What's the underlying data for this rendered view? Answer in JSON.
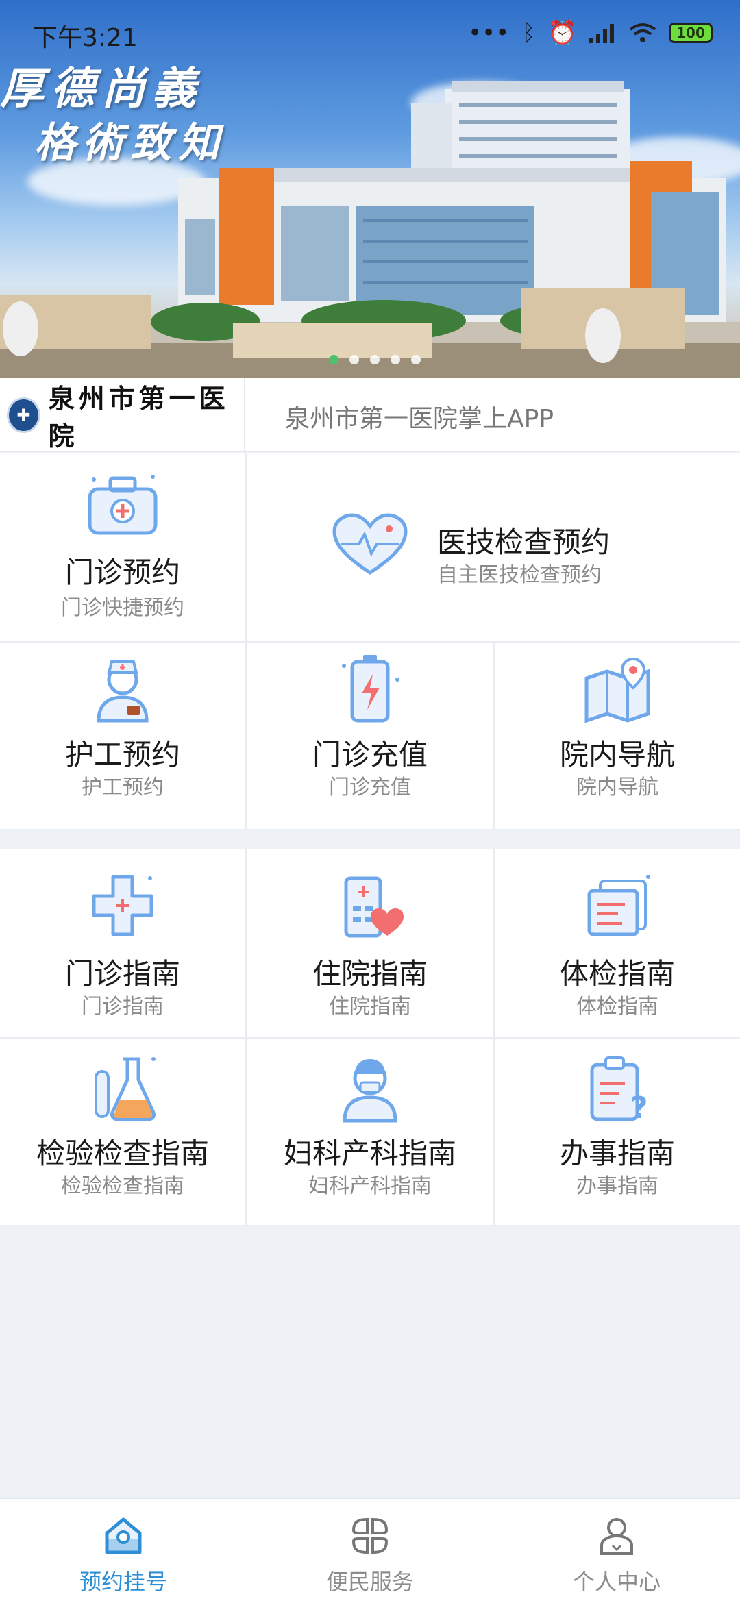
{
  "status_bar": {
    "time": "下午3:21",
    "battery": "100",
    "icons": [
      "more-dots-icon",
      "bluetooth-icon",
      "alarm-icon",
      "signal-icon",
      "wifi-icon",
      "battery-icon"
    ]
  },
  "banner": {
    "line1": "厚德尚義",
    "line2": "格術致知",
    "slides": 5,
    "active_slide": 1
  },
  "hospital": {
    "logo_text": "泉州市第一医院",
    "app_title": "泉州市第一医院掌上APP"
  },
  "services": [
    {
      "title": "门诊预约",
      "sub": "门诊快捷预约",
      "icon": "medical-kit-icon"
    },
    {
      "title": "医技检查预约",
      "sub": "自主医技检查预约",
      "icon": "heart-pulse-icon"
    },
    {
      "title": "护工预约",
      "sub": "护工预约",
      "icon": "nurse-icon"
    },
    {
      "title": "门诊充值",
      "sub": "门诊充值",
      "icon": "battery-charge-icon"
    },
    {
      "title": "院内导航",
      "sub": "院内导航",
      "icon": "map-pin-icon"
    }
  ],
  "guides": [
    {
      "title": "门诊指南",
      "sub": "门诊指南",
      "icon": "cross-icon"
    },
    {
      "title": "住院指南",
      "sub": "住院指南",
      "icon": "hospital-heart-icon"
    },
    {
      "title": "体检指南",
      "sub": "体检指南",
      "icon": "documents-icon"
    },
    {
      "title": "检验检查指南",
      "sub": "检验检查指南",
      "icon": "lab-flask-icon"
    },
    {
      "title": "妇科产科指南",
      "sub": "妇科产科指南",
      "icon": "doctor-icon"
    },
    {
      "title": "办事指南",
      "sub": "办事指南",
      "icon": "clipboard-question-icon"
    }
  ],
  "nav": [
    {
      "label": "预约挂号",
      "icon": "home-icon",
      "active": true
    },
    {
      "label": "便民服务",
      "icon": "grid-service-icon",
      "active": false
    },
    {
      "label": "个人中心",
      "icon": "user-icon",
      "active": false
    }
  ],
  "colors": {
    "accent": "#2e8fd6",
    "icon_blue": "#6fa8ea",
    "icon_red": "#f36f6f",
    "icon_orange": "#f4a65c"
  }
}
